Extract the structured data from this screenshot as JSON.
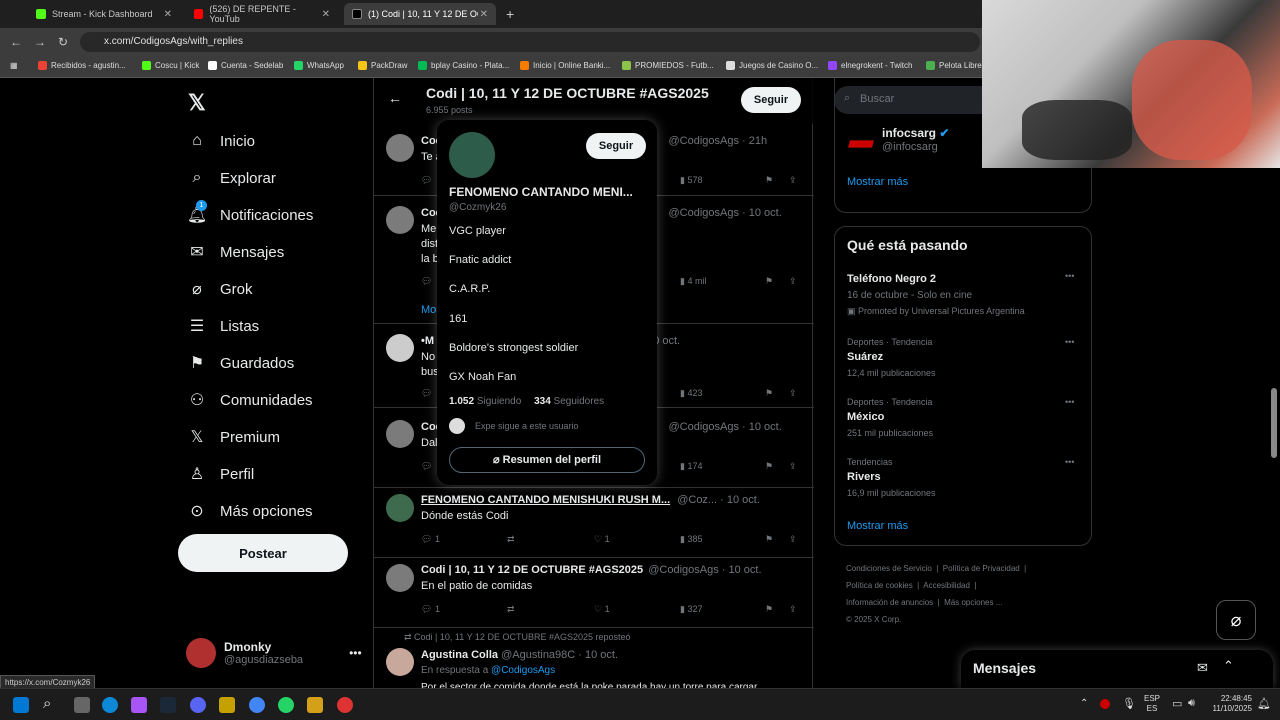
{
  "browser": {
    "tabs": [
      {
        "label": "Stream - Kick Dashboard"
      },
      {
        "label": "(526) DE REPENTE - YouTub"
      },
      {
        "label": "(1) Codi | 10, 11 Y 12 DE OCTUB"
      }
    ],
    "url": "x.com/CodigosAgs/with_replies",
    "bookmarks": [
      "Recibidos - agustin...",
      "Coscu | Kick",
      "Cuenta - Sedelab",
      "WhatsApp",
      "PackDraw",
      "bplay Casino - Plata...",
      "Inicio | Online Banki...",
      "PROMIEDOS - Futb...",
      "Juegos de Casino O...",
      "elnegrokent - Twitch",
      "Pelota Libre"
    ],
    "status_link": "https://x.com/Cozmyk26"
  },
  "nav": {
    "items": [
      "Inicio",
      "Explorar",
      "Notificaciones",
      "Mensajes",
      "Grok",
      "Listas",
      "Guardados",
      "Comunidades",
      "Premium",
      "Perfil",
      "Más opciones"
    ],
    "notif_badge": "1",
    "post_label": "Postear",
    "me_name": "Dmonky",
    "me_handle": "@agusdiazseba"
  },
  "header": {
    "title": "Codi | 10, 11 Y 12 DE OCTUBRE #AGS2025",
    "posts": "6.955 posts",
    "follow": "Seguir"
  },
  "tweets": [
    {
      "name": "Codi",
      "meta": "@CodigosAgs · 21h",
      "text": "Te a",
      "views": "578"
    },
    {
      "name": "Codi",
      "meta": "@CodigosAgs · 10 oct.",
      "text": "Me ... das y etc, pero estoy",
      "text2": "dist ... Además estoy jugado con",
      "text3": "la b",
      "views": "4 mil",
      "more": "Mo"
    },
    {
      "name": "•M",
      "meta": "10 oct.",
      "text": "No ... manos BDJFIJA después te",
      "text2": "bus",
      "views": "423"
    },
    {
      "name": "Codi",
      "meta": "@CodigosAgs · 10 oct.",
      "text": "Dal",
      "views": "174"
    },
    {
      "name": "FENOMENO CANTANDO MENISHUKI RUSH M...",
      "meta": "@Coz... · 10 oct.",
      "text": "Dónde estás Codi",
      "replies": "1",
      "likes": "1",
      "views": "385"
    },
    {
      "name": "Codi | 10, 11 Y 12 DE OCTUBRE #AGS2025",
      "meta": "@CodigosAgs · 10 oct.",
      "text": "En el patio de comidas",
      "replies": "1",
      "likes": "1",
      "views": "327"
    },
    {
      "repost": "Codi | 10, 11 Y 12 DE OCTUBRE #AGS2025 reposteó",
      "name": "Agustina Colla",
      "meta": "@Agustina98C · 10 oct.",
      "reply_to": "En respuesta a",
      "reply_handle": "@CodigosAgs",
      "text": "Por el sector de comida donde está la poke parada hay un torre para cargar"
    }
  ],
  "popup": {
    "name": "FENOMENO CANTANDO MENI...",
    "handle": "@Cozmyk26",
    "follow": "Seguir",
    "bio": [
      "VGC player",
      "Fnatic addict",
      "C.A.R.P.",
      "161",
      "Boldore's strongest soldier",
      "GX Noah Fan"
    ],
    "following_count": "1.052",
    "following_label": "Siguiendo",
    "followers_count": "334",
    "followers_label": "Seguidores",
    "followed_by": "Expe sigue a este usuario",
    "summary": "Resumen del perfil"
  },
  "right": {
    "search": "Buscar",
    "infocs_name": "infocsarg",
    "infocs_handle": "@infocsarg",
    "show_more": "Mostrar más",
    "trends_title": "Qué está pasando",
    "trends": [
      {
        "name": "Teléfono Negro 2",
        "sub": "16 de octubre - Solo en cine",
        "promo": "Promoted by Universal Pictures Argentina"
      },
      {
        "cat": "Deportes · Tendencia",
        "name": "Suárez",
        "sub": "12,4 mil publicaciones"
      },
      {
        "cat": "Deportes · Tendencia",
        "name": "México",
        "sub": "251 mil publicaciones"
      },
      {
        "cat": "Tendencias",
        "name": "Rivers",
        "sub": "16,9 mil publicaciones"
      }
    ],
    "footer": [
      "Condiciones de Servicio",
      "Política de Privacidad",
      "Política de cookies",
      "Accesibilidad",
      "Información de anuncios",
      "Más opciones ...",
      "© 2025 X Corp."
    ],
    "messages": "Mensajes"
  },
  "taskbar": {
    "lang": "ESP",
    "lang2": "ES",
    "time": "22:48:45",
    "date": "11/10/2025"
  },
  "colors": {
    "accent": "#1d9bf0",
    "bg": "#000000",
    "border": "#2f3336"
  }
}
